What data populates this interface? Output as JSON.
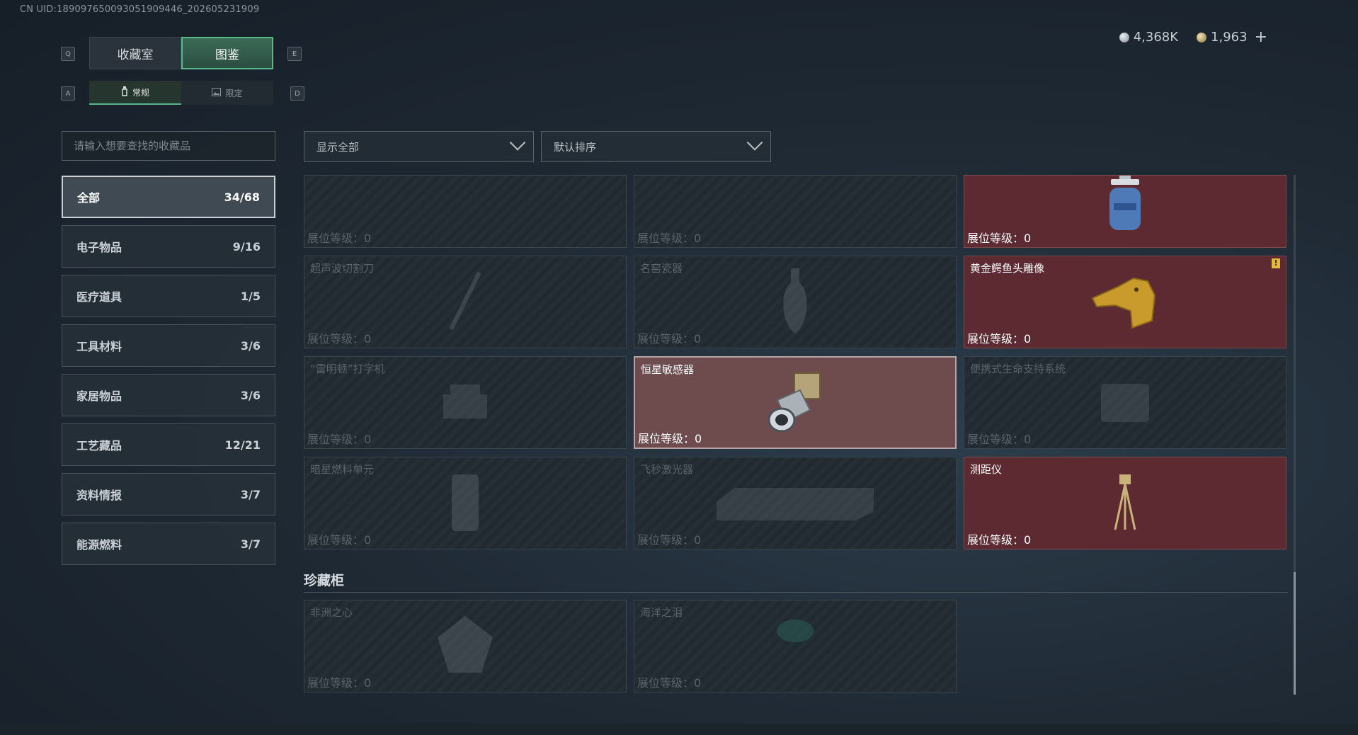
{
  "uid_text": "CN UID:18909765009305190944​6_202605231909",
  "currency": {
    "silver": "4,368K",
    "gold": "1,963",
    "plus": "+"
  },
  "keys": {
    "q": "Q",
    "e": "E",
    "a": "A",
    "d": "D"
  },
  "tabs": [
    {
      "label": "收藏室"
    },
    {
      "label": "图鉴"
    }
  ],
  "subtabs": [
    {
      "label": "常规"
    },
    {
      "label": "限定"
    }
  ],
  "search": {
    "placeholder": "请输入想要查找的收藏品"
  },
  "categories": [
    {
      "label": "全部",
      "count": "34/68"
    },
    {
      "label": "电子物品",
      "count": "9/16"
    },
    {
      "label": "医疗道具",
      "count": "1/5"
    },
    {
      "label": "工具材料",
      "count": "3/6"
    },
    {
      "label": "家居物品",
      "count": "3/6"
    },
    {
      "label": "工艺藏品",
      "count": "12/21"
    },
    {
      "label": "资料情报",
      "count": "3/7"
    },
    {
      "label": "能源燃料",
      "count": "3/7"
    }
  ],
  "filters": {
    "show": "显示全部",
    "sort": "默认排序"
  },
  "level_label": "展位等级：",
  "items": [
    {
      "name": "",
      "level": "0"
    },
    {
      "name": "",
      "level": "0"
    },
    {
      "name": "",
      "level": "0"
    },
    {
      "name": "超声波切割刀",
      "level": "0"
    },
    {
      "name": "名窑瓷器",
      "level": "0"
    },
    {
      "name": "黄金鳄鱼头雕像",
      "level": "0"
    },
    {
      "name": "“雷明顿”打字机",
      "level": "0"
    },
    {
      "name": "恒星敏感器",
      "level": "0"
    },
    {
      "name": "便携式生命支持系统",
      "level": "0"
    },
    {
      "name": "暗星燃料单元",
      "level": "0"
    },
    {
      "name": "飞秒激光器",
      "level": "0"
    },
    {
      "name": "测距仪",
      "level": "0"
    }
  ],
  "section": {
    "title": "珍藏柜"
  },
  "cabinet_items": [
    {
      "name": "非洲之心",
      "level": "0"
    },
    {
      "name": "海洋之泪",
      "level": "0"
    }
  ]
}
